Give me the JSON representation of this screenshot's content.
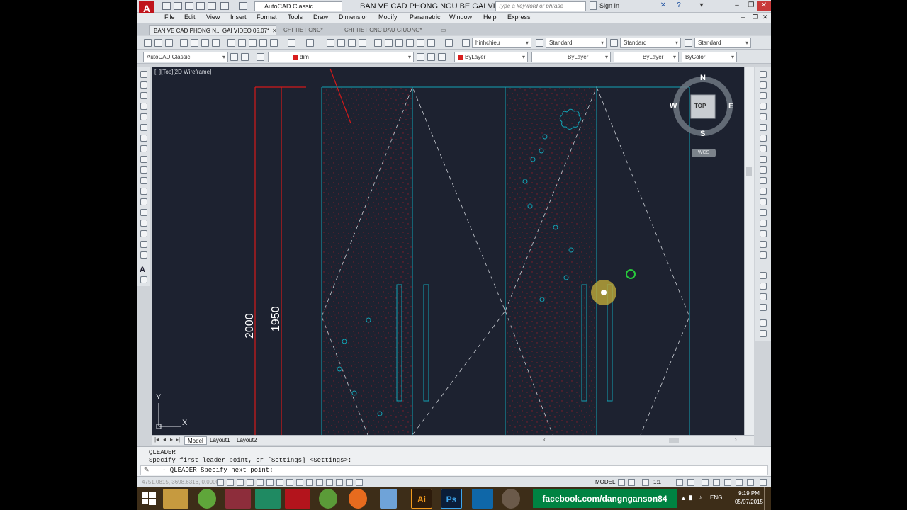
{
  "titlebar": {
    "workspace": "AutoCAD Classic",
    "doc_title": "BAN VE CAD PHONG NGU BE GAI VID...",
    "search_placeholder": "Type a keyword or phrase",
    "signin": "Sign In"
  },
  "menu": [
    "File",
    "Edit",
    "View",
    "Insert",
    "Format",
    "Tools",
    "Draw",
    "Dimension",
    "Modify",
    "Parametric",
    "Window",
    "Help",
    "Express"
  ],
  "tabs": [
    {
      "label": "BAN VE CAD PHONG N... GAI VIDEO 05.07*",
      "active": true
    },
    {
      "label": "CHI TIET CNC*",
      "active": false
    },
    {
      "label": "CHI TIET CNC DAU GIUONG*",
      "active": false
    }
  ],
  "toolbar1": {
    "text_style": "hinhchieu",
    "dim_style": "Standard",
    "table_style": "Standard",
    "mleader_style": "Standard"
  },
  "toolbar2": {
    "workspace": "AutoCAD Classic",
    "layer": "dim",
    "color": "ByLayer",
    "linetype": "ByLayer",
    "lineweight": "ByLayer",
    "plotstyle": "ByColor"
  },
  "viewport": {
    "label": "[−][Top][2D Wireframe]"
  },
  "dimensions": {
    "outer": "2000",
    "inner": "1950"
  },
  "viewcube": {
    "north": "N",
    "south": "S",
    "east": "E",
    "west": "W",
    "face": "TOP",
    "wcs": "WCS"
  },
  "ucs": {
    "x": "X",
    "y": "Y"
  },
  "layout_tabs": [
    "Model",
    "Layout1",
    "Layout2"
  ],
  "command": {
    "line1": "QLEADER",
    "line2": "Specify first leader point, or [Settings] <Settings>:",
    "input": "- QLEADER Specify next point:"
  },
  "status": {
    "coords": "4751.0815, 3698.6316, 0.0000",
    "model": "MODEL",
    "scale": "1:1"
  },
  "taskbar": {
    "banner": "facebook.com/dangnganson84",
    "lang": "ENG",
    "time": "9:19 PM",
    "date": "05/07/2015",
    "apps": [
      "Ai",
      "Ps"
    ]
  },
  "colors": {
    "canvas": "#1d2230",
    "cyan": "#13a3b5",
    "red": "#d41a1a",
    "taskbar_green": "#008342"
  }
}
